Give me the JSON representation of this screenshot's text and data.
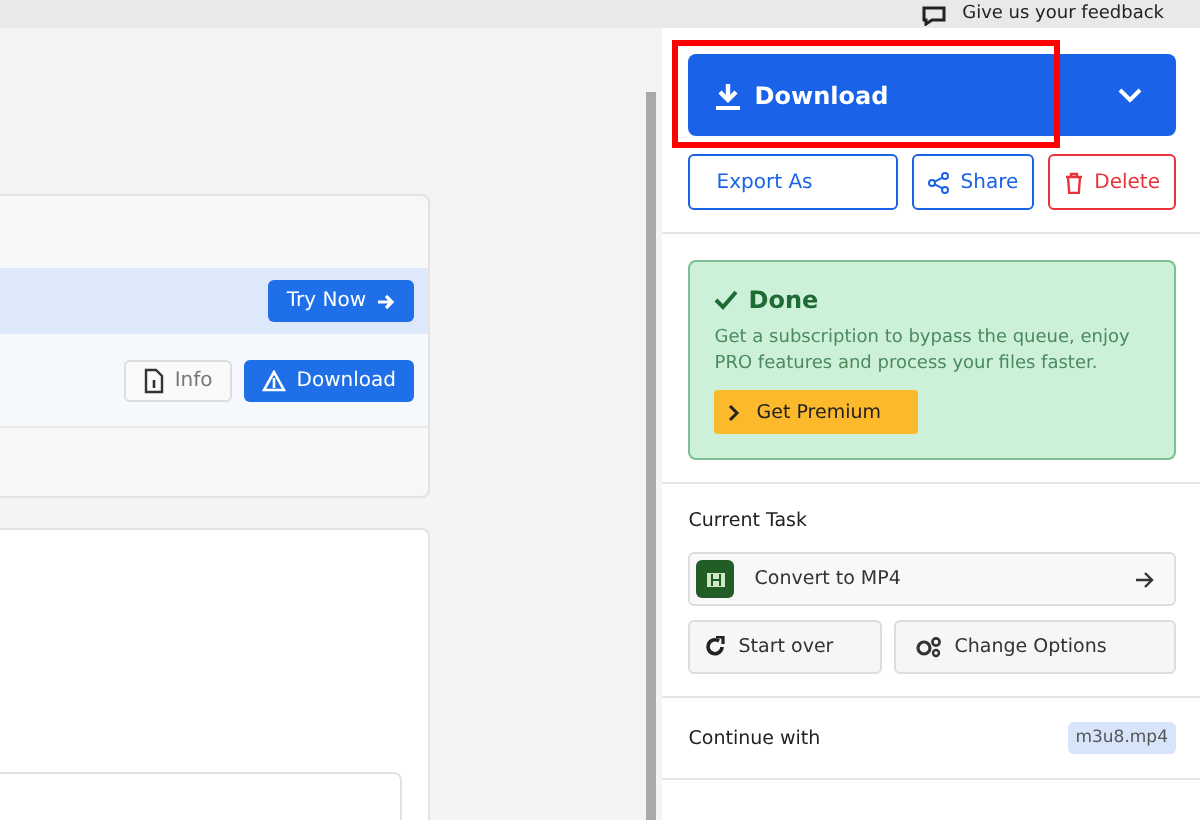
{
  "top_bar": {
    "feedback_link": "Give us your feedback"
  },
  "file_card": {
    "promo_button": "Try Now",
    "info_button": "Info",
    "download_button": "Download"
  },
  "sidebar": {
    "download_button": "Download",
    "highlighted": true,
    "actions": [
      {
        "kind": "export",
        "label": "Export As"
      },
      {
        "kind": "share",
        "label": "Share"
      },
      {
        "kind": "delete",
        "label": "Delete"
      }
    ],
    "status": {
      "title": "Done",
      "message": "Get a subscription to bypass the queue, enjoy PRO features and process your files faster.",
      "button": "Get Premium"
    },
    "current_task": {
      "heading": "Current Task",
      "task": "Convert to MP4",
      "buttons": [
        {
          "kind": "restart",
          "label": "Start over"
        },
        {
          "kind": "options",
          "label": "Change Options"
        }
      ]
    },
    "continue_with": {
      "label": "Continue with",
      "file": "m3u8.mp4"
    }
  }
}
